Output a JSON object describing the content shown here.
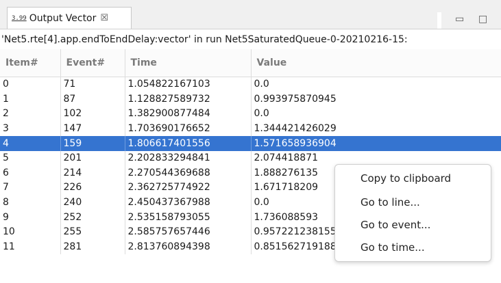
{
  "tab": {
    "icon_text": "3.99\n0.00",
    "label": "Output Vector",
    "close_glyph": "☒"
  },
  "window_controls": {
    "minimize": "▭",
    "maximize": "□"
  },
  "subtitle": "'Net5.rte[4].app.endToEndDelay:vector' in run Net5SaturatedQueue-0-20210216-15:",
  "table": {
    "headers": [
      "Item#",
      "Event#",
      "Time",
      "Value"
    ],
    "selected_index": 4,
    "rows": [
      [
        "0",
        "71",
        "1.054822167103",
        "0.0"
      ],
      [
        "1",
        "87",
        "1.128827589732",
        "0.993975870945"
      ],
      [
        "2",
        "102",
        "1.382900877484",
        "0.0"
      ],
      [
        "3",
        "147",
        "1.703690176652",
        "1.344421426029"
      ],
      [
        "4",
        "159",
        "1.806617401556",
        "1.571658936904"
      ],
      [
        "5",
        "201",
        "2.202833294841",
        "2.074418871"
      ],
      [
        "6",
        "214",
        "2.270544369688",
        "1.888276135"
      ],
      [
        "7",
        "226",
        "2.362725774922",
        "1.671718209"
      ],
      [
        "8",
        "240",
        "2.450437367988",
        "0.0"
      ],
      [
        "9",
        "252",
        "2.535158793055",
        "1.736088593"
      ],
      [
        "10",
        "255",
        "2.585757657446",
        "0.957221238155"
      ],
      [
        "11",
        "281",
        "2.813760894398",
        "0.851562719188"
      ]
    ]
  },
  "context_menu": {
    "items": [
      "Copy to clipboard",
      "Go to line...",
      "Go to event...",
      "Go to time..."
    ]
  },
  "colors": {
    "selection": "#3574d0",
    "header_text": "#7a7a7a"
  }
}
